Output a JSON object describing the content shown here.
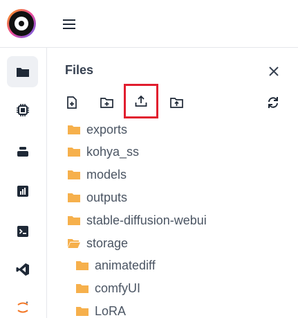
{
  "panel": {
    "title": "Files"
  },
  "toolbar": {
    "tools": [
      {
        "name": "new-file-icon"
      },
      {
        "name": "new-folder-icon"
      },
      {
        "name": "upload-icon"
      },
      {
        "name": "upload-folder-icon"
      },
      {
        "name": "refresh-icon"
      }
    ]
  },
  "tree": {
    "items": [
      {
        "label": "exports",
        "open": false,
        "depth": 0
      },
      {
        "label": "kohya_ss",
        "open": false,
        "depth": 0
      },
      {
        "label": "models",
        "open": false,
        "depth": 0
      },
      {
        "label": "outputs",
        "open": false,
        "depth": 0
      },
      {
        "label": "stable-diffusion-webui",
        "open": false,
        "depth": 0
      },
      {
        "label": "storage",
        "open": true,
        "depth": 0
      },
      {
        "label": "animatediff",
        "open": false,
        "depth": 1
      },
      {
        "label": "comfyUI",
        "open": false,
        "depth": 1
      },
      {
        "label": "LoRA",
        "open": false,
        "depth": 1
      }
    ]
  },
  "rail": {
    "items": [
      {
        "name": "files-icon",
        "active": true
      },
      {
        "name": "chip-icon",
        "active": false
      },
      {
        "name": "storage-icon",
        "active": false
      },
      {
        "name": "chart-icon",
        "active": false
      },
      {
        "name": "terminal-icon",
        "active": false
      },
      {
        "name": "vscode-icon",
        "active": false
      },
      {
        "name": "jupyter-icon",
        "active": false
      }
    ]
  },
  "colors": {
    "folder": "#f6b04c",
    "highlight": "#e11d2e",
    "icon": "#1f2937"
  }
}
